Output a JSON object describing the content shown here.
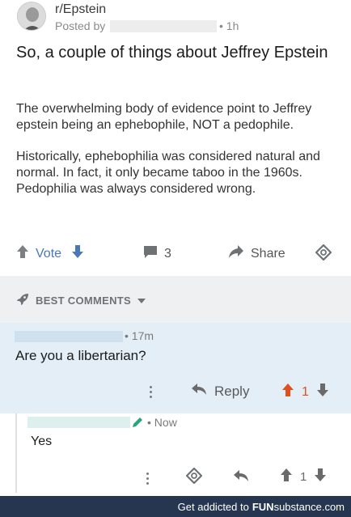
{
  "post": {
    "subreddit": "r/Epstein",
    "posted_by_prefix": "Posted by",
    "time": "• 1h",
    "title": "So, a couple of things about Jeffrey Epstein",
    "body": [
      "The overwhelming body of evidence point to Jeffrey epstein being an ephebophile, NOT a pedophile.",
      "Historically, ephebophilia was considered natural and normal. In fact, it only became taboo in the 1960s. Pedophilia was always considered wrong."
    ]
  },
  "actions": {
    "vote_label": "Vote",
    "comment_count": "3",
    "share_label": "Share"
  },
  "comments_header": {
    "sort_label": "BEST COMMENTS"
  },
  "comments": [
    {
      "time": "• 17m",
      "text": "Are you a libertarian?",
      "reply_label": "Reply",
      "score": "1",
      "upvoted": true
    },
    {
      "time": "• Now",
      "text": "Yes",
      "score": "1",
      "upvoted": false
    }
  ],
  "footer": {
    "tagline": "Get addicted to",
    "brand_bold": "FUN",
    "brand_thin": "substance",
    "brand_suffix": ".com"
  },
  "colors": {
    "accent_blue": "#4a78b8",
    "upvote_orange": "#e0501f",
    "highlight_comment_bg": "#e3eef7",
    "footer_bg": "#263650"
  }
}
